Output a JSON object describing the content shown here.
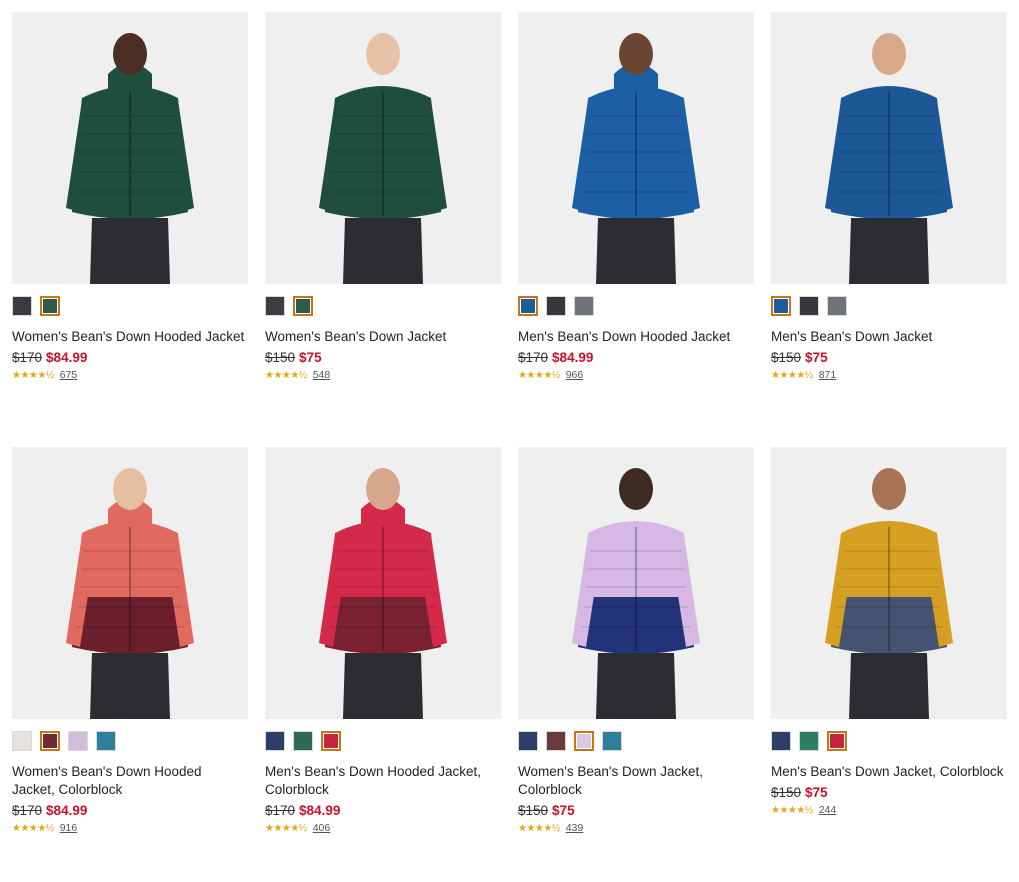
{
  "products": [
    {
      "name": "Women's Bean's Down Hooded Jacket",
      "orig_price": "$170",
      "sale_price": "$84.99",
      "rating_stars": "★★★★½",
      "review_count": "675",
      "swatches": [
        "#3a3b40",
        "#2e5a4c"
      ],
      "selected_swatch": 1,
      "jacket_colors": [
        "#1f4d3e",
        "#1f4d3e"
      ],
      "skin": "#4b2f24",
      "hood": true
    },
    {
      "name": "Women's Bean's Down Jacket",
      "orig_price": "$150",
      "sale_price": "$75",
      "rating_stars": "★★★★½",
      "review_count": "548",
      "swatches": [
        "#3c3d42",
        "#2e5a4c"
      ],
      "selected_swatch": 1,
      "jacket_colors": [
        "#1f4d3e",
        "#1f4d3e"
      ],
      "skin": "#e7c2a8",
      "hood": false
    },
    {
      "name": "Men's Bean's Down Hooded Jacket",
      "orig_price": "$170",
      "sale_price": "$84.99",
      "rating_stars": "★★★★½",
      "review_count": "966",
      "swatches": [
        "#1e5c9a",
        "#35373c",
        "#6f7278"
      ],
      "selected_swatch": 0,
      "jacket_colors": [
        "#1d5fa5",
        "#1d5fa5"
      ],
      "skin": "#6b4632",
      "hood": true
    },
    {
      "name": "Men's Bean's Down Jacket",
      "orig_price": "$150",
      "sale_price": "$75",
      "rating_stars": "★★★★½",
      "review_count": "871",
      "swatches": [
        "#1e5c9a",
        "#35373c",
        "#6f7278"
      ],
      "selected_swatch": 0,
      "jacket_colors": [
        "#1d5896",
        "#1d5896"
      ],
      "skin": "#d8a889",
      "hood": false
    },
    {
      "name": "Women's Bean's Down Hooded Jacket, Colorblock",
      "orig_price": "$170",
      "sale_price": "$84.99",
      "rating_stars": "★★★★½",
      "review_count": "916",
      "swatches": [
        "#e6e3de",
        "#6b2b2f",
        "#d3bcd9",
        "#2e7e9e"
      ],
      "selected_swatch": 1,
      "jacket_colors": [
        "#e06a5f",
        "#6b1e2c"
      ],
      "skin": "#e5bfa2",
      "hood": true
    },
    {
      "name": "Men's Bean's Down Hooded Jacket, Colorblock",
      "orig_price": "$170",
      "sale_price": "$84.99",
      "rating_stars": "★★★★½",
      "review_count": "406",
      "swatches": [
        "#2c3e6a",
        "#2e6a55",
        "#c8243e"
      ],
      "selected_swatch": 2,
      "jacket_colors": [
        "#d32a4a",
        "#7b2232"
      ],
      "skin": "#d6a78a",
      "hood": true
    },
    {
      "name": "Women's Bean's Down Jacket, Colorblock",
      "orig_price": "$150",
      "sale_price": "$75",
      "rating_stars": "★★★★½",
      "review_count": "439",
      "swatches": [
        "#2c3e6a",
        "#6b3b3b",
        "#d8c8e0",
        "#2e7e9e"
      ],
      "selected_swatch": 2,
      "jacket_colors": [
        "#d7b8e4",
        "#22337a"
      ],
      "skin": "#3f2a22",
      "hood": false
    },
    {
      "name": "Men's Bean's Down Jacket, Colorblock",
      "orig_price": "$150",
      "sale_price": "$75",
      "rating_stars": "★★★★½",
      "review_count": "244",
      "swatches": [
        "#2c3e6a",
        "#2e7d62",
        "#c8243e"
      ],
      "selected_swatch": 2,
      "jacket_colors": [
        "#d5a021",
        "#455370"
      ],
      "skin": "#a87255",
      "hood": false
    }
  ]
}
